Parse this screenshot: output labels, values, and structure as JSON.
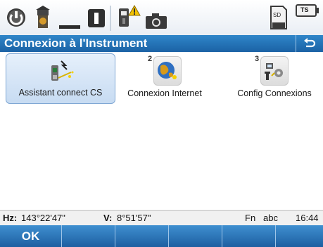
{
  "toolbar": {
    "icons": [
      "power-icon",
      "surveyor-icon",
      "bubble-level-icon",
      "prism-icon",
      "instrument-warning-icon",
      "camera-icon",
      "sd-card-icon",
      "ts-battery-icon"
    ],
    "battery_label": "TS",
    "sd_label": "SD"
  },
  "title": {
    "text": "Connexion à l'Instrument"
  },
  "tiles": [
    {
      "label": "Assistant connect CS",
      "badge": "",
      "selected": true
    },
    {
      "label": "Connexion Internet",
      "badge": "2",
      "selected": false
    },
    {
      "label": "Config Connexions",
      "badge": "3",
      "selected": false
    }
  ],
  "status": {
    "hz_label": "Hz:",
    "hz_value": "143°22'47\"",
    "v_label": "V:",
    "v_value": "8°51'57\"",
    "fn": "Fn",
    "input_mode": "abc",
    "time": "16:44"
  },
  "softkeys": {
    "ok": "OK",
    "f2": "",
    "f3": "",
    "f4": "",
    "f5": "",
    "f6": ""
  },
  "colors": {
    "title_bg": "#1b62a5",
    "softkey_bg": "#1d5fa1",
    "tile_selected": "#c7dbf2"
  }
}
